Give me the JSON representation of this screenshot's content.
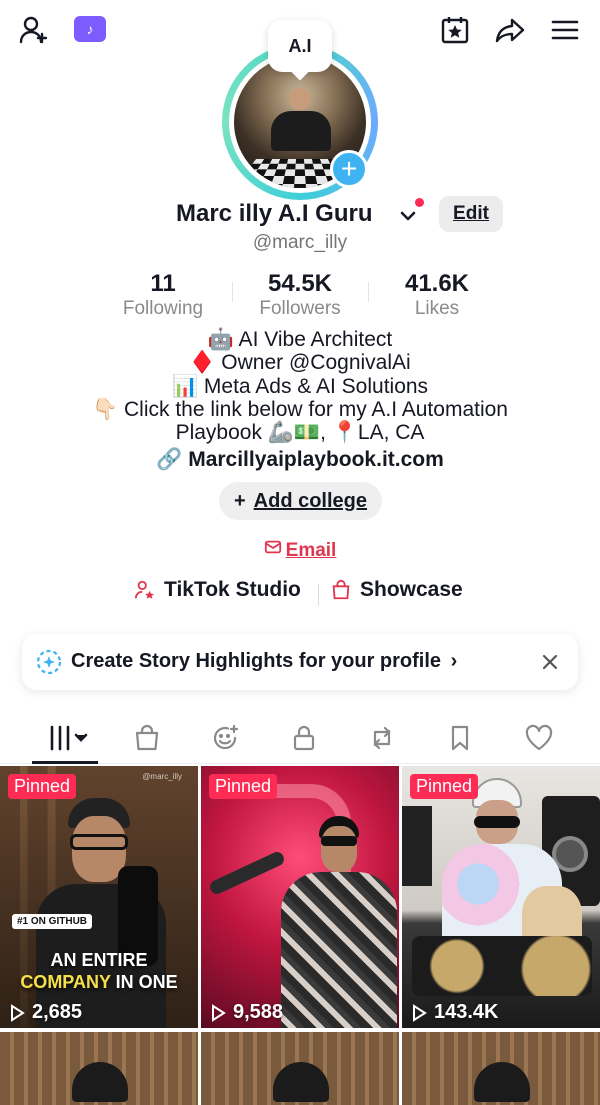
{
  "top_bar": {
    "add_friend_icon": "person-add-icon",
    "tiktok_badge_icon": "tiktok-note-icon",
    "calendar_icon": "calendar-star-icon",
    "share_icon": "share-arrow-icon",
    "menu_icon": "hamburger-menu-icon"
  },
  "profile": {
    "ai_badge": "A.I",
    "name": "Marc illy A.I Guru",
    "handle": "@marc_illy",
    "edit_label": "Edit",
    "stats": [
      {
        "value": "11",
        "label": "Following"
      },
      {
        "value": "54.5K",
        "label": "Followers"
      },
      {
        "value": "41.6K",
        "label": "Likes"
      }
    ],
    "bio": [
      "🤖 AI Vibe Architect",
      "♦️ Owner @CognivalAi",
      "📊 Meta Ads & AI Solutions",
      "👇🏻 Click the link below for my A.I Automation",
      "Playbook 🦾💵, 📍LA, CA"
    ],
    "link": "Marcillyaiplaybook.it.com",
    "add_college": "Add college",
    "email": "Email",
    "tiktok_studio": "TikTok Studio",
    "showcase": "Showcase"
  },
  "story_card": {
    "text": "Create Story Highlights for your profile",
    "chevron": "›"
  },
  "tabs": [
    {
      "name": "videos",
      "icon": "grid-bars-icon",
      "active": true
    },
    {
      "name": "shop",
      "icon": "shopping-bag-icon"
    },
    {
      "name": "ai-self",
      "icon": "smiley-sparkle-icon"
    },
    {
      "name": "private",
      "icon": "lock-icon"
    },
    {
      "name": "reposts",
      "icon": "repost-icon"
    },
    {
      "name": "favorites",
      "icon": "bookmark-icon"
    },
    {
      "name": "liked",
      "icon": "heart-icon"
    }
  ],
  "videos": [
    {
      "pinned": "Pinned",
      "views": "2,685",
      "badge": "#1 ON GITHUB",
      "caption_line1": "AN ENTIRE",
      "caption_line2_hl": "COMPANY",
      "caption_line2_rest": " IN ONE",
      "watermark": "@marc_illy"
    },
    {
      "pinned": "Pinned",
      "views": "9,588"
    },
    {
      "pinned": "Pinned",
      "views": "143.4K"
    }
  ],
  "colors": {
    "accent_red": "#fe2c55",
    "email_red": "#e0364e",
    "plus_blue": "#3fb3f2",
    "tiktok_purple": "#7c5cff"
  }
}
